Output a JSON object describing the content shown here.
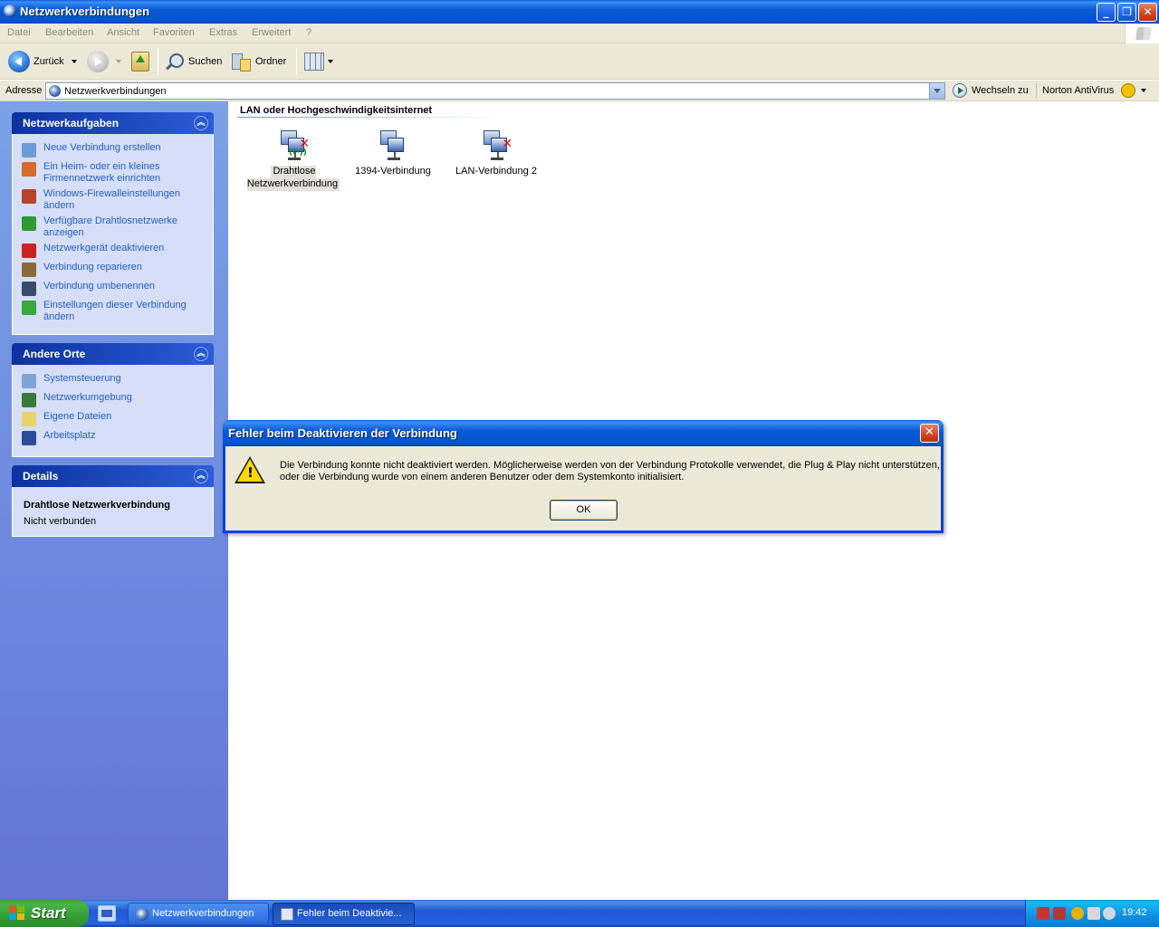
{
  "window": {
    "title": "Netzwerkverbindungen",
    "controls": {
      "minimize": "_",
      "maximize": "❐",
      "close": "✕"
    }
  },
  "menu": [
    "Datei",
    "Bearbeiten",
    "Ansicht",
    "Favoriten",
    "Extras",
    "Erweitert",
    "?"
  ],
  "toolbar": {
    "back_label": "Zurück",
    "search_label": "Suchen",
    "folders_label": "Ordner"
  },
  "address": {
    "label": "Adresse",
    "value": "Netzwerkverbindungen",
    "go_label": "Wechseln zu",
    "norton_label": "Norton AntiVirus"
  },
  "sidebar": {
    "tasks": {
      "title": "Netzwerkaufgaben",
      "items": [
        {
          "label": "Neue Verbindung erstellen",
          "icon": "new-connection-icon",
          "color": "#6d9ad8"
        },
        {
          "label": "Ein Heim- oder ein kleines Firmennetzwerk einrichten",
          "icon": "home-network-icon",
          "color": "#d86a2a"
        },
        {
          "label": "Windows-Firewalleinstellungen ändern",
          "icon": "firewall-icon",
          "color": "#b8432a"
        },
        {
          "label": "Verfügbare Drahtlosnetzwerke anzeigen",
          "icon": "wireless-icon",
          "color": "#2f9a2f"
        },
        {
          "label": "Netzwerkgerät deaktivieren",
          "icon": "disable-device-icon",
          "color": "#cc2222"
        },
        {
          "label": "Verbindung reparieren",
          "icon": "repair-icon",
          "color": "#8a6a3a"
        },
        {
          "label": "Verbindung umbenennen",
          "icon": "rename-icon",
          "color": "#3a4a6a"
        },
        {
          "label": "Einstellungen dieser Verbindung ändern",
          "icon": "settings-icon",
          "color": "#3aa83a"
        }
      ]
    },
    "places": {
      "title": "Andere Orte",
      "items": [
        {
          "label": "Systemsteuerung",
          "icon": "control-panel-icon",
          "color": "#7fa2d8"
        },
        {
          "label": "Netzwerkumgebung",
          "icon": "network-places-icon",
          "color": "#3a7a3a"
        },
        {
          "label": "Eigene Dateien",
          "icon": "my-documents-icon",
          "color": "#e8d36a"
        },
        {
          "label": "Arbeitsplatz",
          "icon": "my-computer-icon",
          "color": "#2b4c9a"
        }
      ]
    },
    "details": {
      "title": "Details",
      "name": "Drahtlose Netzwerkverbindung",
      "status": "Nicht verbunden"
    }
  },
  "content": {
    "group_title": "LAN oder Hochgeschwindigkeitsinternet",
    "connections": [
      {
        "label": "Drahtlose Netzwerkverbindung",
        "icon": "wireless-connection-icon",
        "disconnected": true,
        "selected": true
      },
      {
        "label": "1394-Verbindung",
        "icon": "network-connection-icon",
        "disconnected": false,
        "selected": false
      },
      {
        "label": "LAN-Verbindung 2",
        "icon": "lan-connection-icon",
        "disconnected": true,
        "selected": false
      }
    ]
  },
  "dialog": {
    "title": "Fehler beim Deaktivieren der Verbindung",
    "message": "Die Verbindung konnte nicht deaktiviert werden. Möglicherweise werden von der Verbindung Protokolle verwendet, die Plug & Play nicht unterstützen, oder die Verbindung wurde von einem anderen Benutzer oder dem Systemkonto initialisiert.",
    "ok_label": "OK",
    "close_glyph": "✕"
  },
  "taskbar": {
    "start_label": "Start",
    "tasks": [
      {
        "label": "Netzwerkverbindungen",
        "active": false
      },
      {
        "label": "Fehler beim Deaktivie...",
        "active": true
      }
    ],
    "clock": "19:42"
  }
}
